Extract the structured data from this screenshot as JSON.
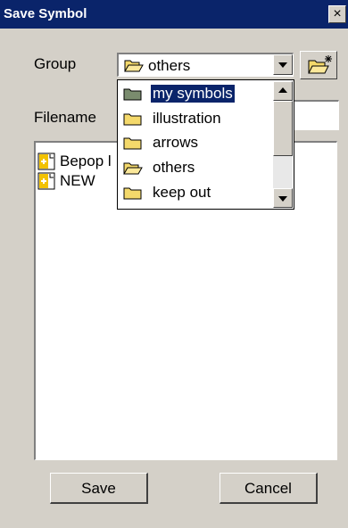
{
  "window": {
    "title": "Save Symbol",
    "close_glyph": "×"
  },
  "form": {
    "group_label": "Group",
    "group_value": "others",
    "filename_label": "Filename",
    "filename_value": ""
  },
  "group_dropdown": {
    "items": [
      {
        "label": "my symbols",
        "icon": "folder-closed-icon",
        "selected": true
      },
      {
        "label": "illustration",
        "icon": "folder-closed-icon",
        "selected": false
      },
      {
        "label": "arrows",
        "icon": "folder-closed-icon",
        "selected": false
      },
      {
        "label": "others",
        "icon": "folder-open-icon",
        "selected": false
      },
      {
        "label": "keep out",
        "icon": "folder-closed-icon",
        "selected": false
      }
    ]
  },
  "file_list": {
    "items": [
      {
        "label": "Bepop l",
        "icon": "symbol-file-icon"
      },
      {
        "label": "NEW",
        "icon": "symbol-file-icon"
      }
    ]
  },
  "buttons": {
    "save": "Save",
    "cancel": "Cancel"
  },
  "colors": {
    "title_bar": "#0a246a",
    "dialog_bg": "#d4d0c8",
    "folder": "#f4d96b",
    "selection": "#0a246a"
  }
}
